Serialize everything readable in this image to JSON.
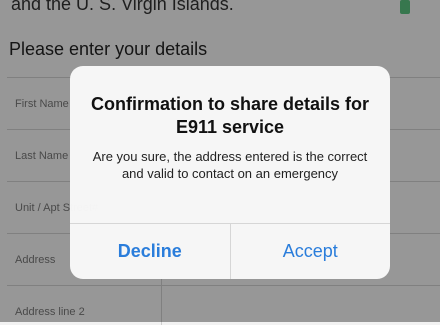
{
  "background": {
    "top_text_prefix": "and the U. S. Virgin Islands.",
    "heading": "Please enter your details",
    "fields": [
      {
        "label": "First Name"
      },
      {
        "label": "Last Name"
      },
      {
        "label": "Unit / Apt Street#"
      },
      {
        "label": "Address"
      },
      {
        "label": "Address line 2"
      }
    ]
  },
  "alert": {
    "title": "Confirmation to share details for E911 service",
    "message": "Are you sure, the address entered is the correct and valid to contact on an emergency",
    "decline_label": "Decline",
    "accept_label": "Accept"
  },
  "colors": {
    "accent": "#2a7ddb",
    "overlay": "rgba(0,0,0,0.38)"
  }
}
